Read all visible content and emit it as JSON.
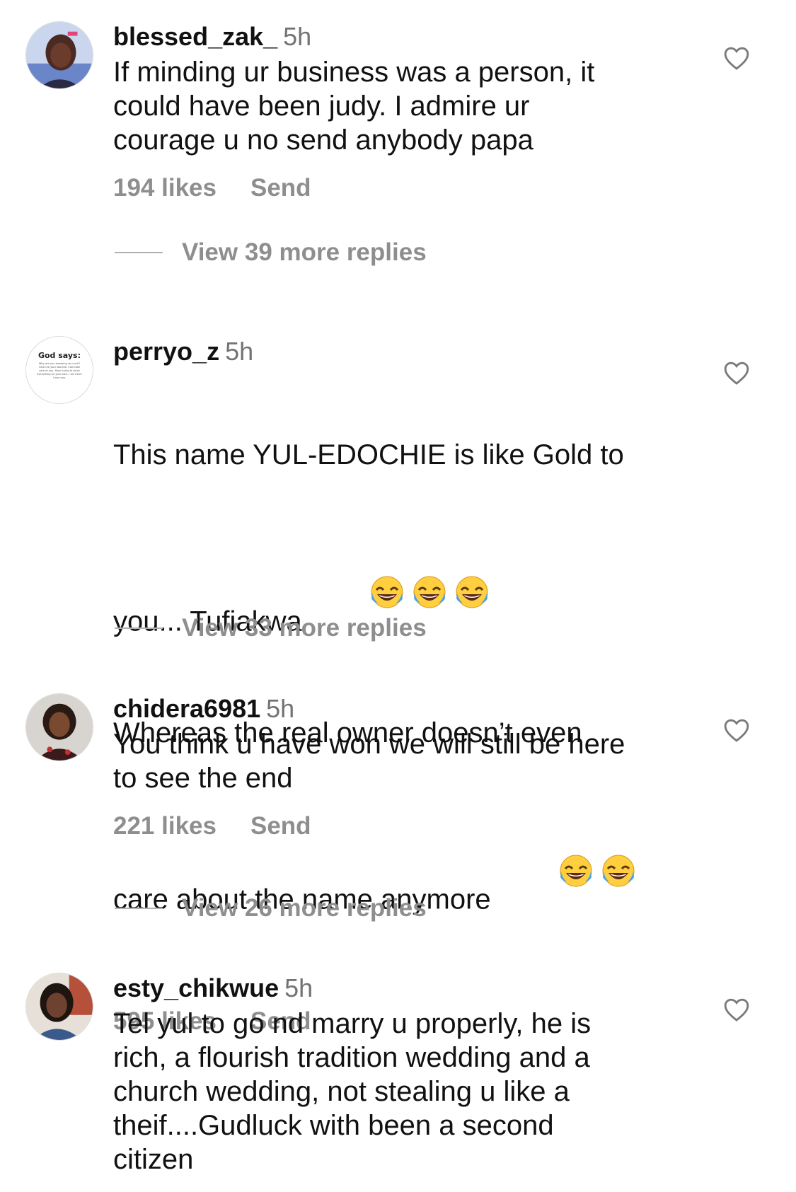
{
  "comments": [
    {
      "username": "blessed_zak_",
      "time": "5h",
      "lines": [
        "If minding ur business was a person, it",
        "could have been judy. I admire ur",
        "courage u no send anybody papa"
      ],
      "likes": "194 likes",
      "send": "Send",
      "replies": "View 39 more replies",
      "avatar_icon": "profile-photo-woman"
    },
    {
      "username": "perryo_z",
      "time": "5h",
      "lines_a": [
        "This name YUL-EDOCHIE is like Gold to"
      ],
      "line_a_last": "you... Tufiakwa",
      "lines_b": [
        "Whereas the real owner doesn’t even"
      ],
      "line_b_last": "care about the name anymore",
      "likes": "595 likes",
      "send": "Send",
      "replies": "View 33 more replies",
      "avatar_title": "God says:",
      "avatar_lines": [
        "Why are you stressing so much?",
        "Give me your worries! I will take",
        "care of you. Stop trying to solve",
        "everything on your own. I am here!",
        "I love you."
      ],
      "emoji_icon": "face-with-tears-of-joy"
    },
    {
      "username": "chidera6981",
      "time": "5h",
      "lines": [
        "You think u have won we will still be here",
        "to see the end"
      ],
      "likes": "221 likes",
      "send": "Send",
      "replies": "View 26 more replies",
      "avatar_icon": "profile-photo-woman"
    },
    {
      "username": "esty_chikwue",
      "time": "5h",
      "lines": [
        "Tel yul to go nd marry u properly, he is",
        "rich, a flourish tradition wedding and a",
        "church wedding, not stealing u like a",
        "theif....Gudluck with been a second",
        "citizen"
      ],
      "avatar_icon": "profile-photo-woman"
    }
  ],
  "colors": {
    "text": "#111111",
    "secondary": "#8e8e8e",
    "timestamp": "#737373"
  },
  "icons": {
    "like": "heart-outline-icon"
  }
}
